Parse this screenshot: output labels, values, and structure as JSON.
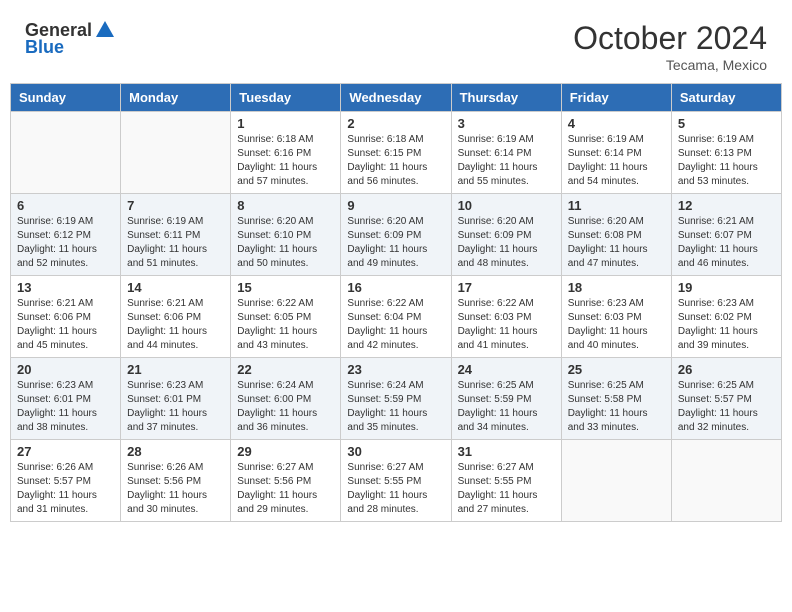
{
  "header": {
    "logo_general": "General",
    "logo_blue": "Blue",
    "month_title": "October 2024",
    "location": "Tecama, Mexico"
  },
  "weekdays": [
    "Sunday",
    "Monday",
    "Tuesday",
    "Wednesday",
    "Thursday",
    "Friday",
    "Saturday"
  ],
  "weeks": [
    [
      {
        "day": "",
        "info": ""
      },
      {
        "day": "",
        "info": ""
      },
      {
        "day": "1",
        "info": "Sunrise: 6:18 AM\nSunset: 6:16 PM\nDaylight: 11 hours and 57 minutes."
      },
      {
        "day": "2",
        "info": "Sunrise: 6:18 AM\nSunset: 6:15 PM\nDaylight: 11 hours and 56 minutes."
      },
      {
        "day": "3",
        "info": "Sunrise: 6:19 AM\nSunset: 6:14 PM\nDaylight: 11 hours and 55 minutes."
      },
      {
        "day": "4",
        "info": "Sunrise: 6:19 AM\nSunset: 6:14 PM\nDaylight: 11 hours and 54 minutes."
      },
      {
        "day": "5",
        "info": "Sunrise: 6:19 AM\nSunset: 6:13 PM\nDaylight: 11 hours and 53 minutes."
      }
    ],
    [
      {
        "day": "6",
        "info": "Sunrise: 6:19 AM\nSunset: 6:12 PM\nDaylight: 11 hours and 52 minutes."
      },
      {
        "day": "7",
        "info": "Sunrise: 6:19 AM\nSunset: 6:11 PM\nDaylight: 11 hours and 51 minutes."
      },
      {
        "day": "8",
        "info": "Sunrise: 6:20 AM\nSunset: 6:10 PM\nDaylight: 11 hours and 50 minutes."
      },
      {
        "day": "9",
        "info": "Sunrise: 6:20 AM\nSunset: 6:09 PM\nDaylight: 11 hours and 49 minutes."
      },
      {
        "day": "10",
        "info": "Sunrise: 6:20 AM\nSunset: 6:09 PM\nDaylight: 11 hours and 48 minutes."
      },
      {
        "day": "11",
        "info": "Sunrise: 6:20 AM\nSunset: 6:08 PM\nDaylight: 11 hours and 47 minutes."
      },
      {
        "day": "12",
        "info": "Sunrise: 6:21 AM\nSunset: 6:07 PM\nDaylight: 11 hours and 46 minutes."
      }
    ],
    [
      {
        "day": "13",
        "info": "Sunrise: 6:21 AM\nSunset: 6:06 PM\nDaylight: 11 hours and 45 minutes."
      },
      {
        "day": "14",
        "info": "Sunrise: 6:21 AM\nSunset: 6:06 PM\nDaylight: 11 hours and 44 minutes."
      },
      {
        "day": "15",
        "info": "Sunrise: 6:22 AM\nSunset: 6:05 PM\nDaylight: 11 hours and 43 minutes."
      },
      {
        "day": "16",
        "info": "Sunrise: 6:22 AM\nSunset: 6:04 PM\nDaylight: 11 hours and 42 minutes."
      },
      {
        "day": "17",
        "info": "Sunrise: 6:22 AM\nSunset: 6:03 PM\nDaylight: 11 hours and 41 minutes."
      },
      {
        "day": "18",
        "info": "Sunrise: 6:23 AM\nSunset: 6:03 PM\nDaylight: 11 hours and 40 minutes."
      },
      {
        "day": "19",
        "info": "Sunrise: 6:23 AM\nSunset: 6:02 PM\nDaylight: 11 hours and 39 minutes."
      }
    ],
    [
      {
        "day": "20",
        "info": "Sunrise: 6:23 AM\nSunset: 6:01 PM\nDaylight: 11 hours and 38 minutes."
      },
      {
        "day": "21",
        "info": "Sunrise: 6:23 AM\nSunset: 6:01 PM\nDaylight: 11 hours and 37 minutes."
      },
      {
        "day": "22",
        "info": "Sunrise: 6:24 AM\nSunset: 6:00 PM\nDaylight: 11 hours and 36 minutes."
      },
      {
        "day": "23",
        "info": "Sunrise: 6:24 AM\nSunset: 5:59 PM\nDaylight: 11 hours and 35 minutes."
      },
      {
        "day": "24",
        "info": "Sunrise: 6:25 AM\nSunset: 5:59 PM\nDaylight: 11 hours and 34 minutes."
      },
      {
        "day": "25",
        "info": "Sunrise: 6:25 AM\nSunset: 5:58 PM\nDaylight: 11 hours and 33 minutes."
      },
      {
        "day": "26",
        "info": "Sunrise: 6:25 AM\nSunset: 5:57 PM\nDaylight: 11 hours and 32 minutes."
      }
    ],
    [
      {
        "day": "27",
        "info": "Sunrise: 6:26 AM\nSunset: 5:57 PM\nDaylight: 11 hours and 31 minutes."
      },
      {
        "day": "28",
        "info": "Sunrise: 6:26 AM\nSunset: 5:56 PM\nDaylight: 11 hours and 30 minutes."
      },
      {
        "day": "29",
        "info": "Sunrise: 6:27 AM\nSunset: 5:56 PM\nDaylight: 11 hours and 29 minutes."
      },
      {
        "day": "30",
        "info": "Sunrise: 6:27 AM\nSunset: 5:55 PM\nDaylight: 11 hours and 28 minutes."
      },
      {
        "day": "31",
        "info": "Sunrise: 6:27 AM\nSunset: 5:55 PM\nDaylight: 11 hours and 27 minutes."
      },
      {
        "day": "",
        "info": ""
      },
      {
        "day": "",
        "info": ""
      }
    ]
  ]
}
